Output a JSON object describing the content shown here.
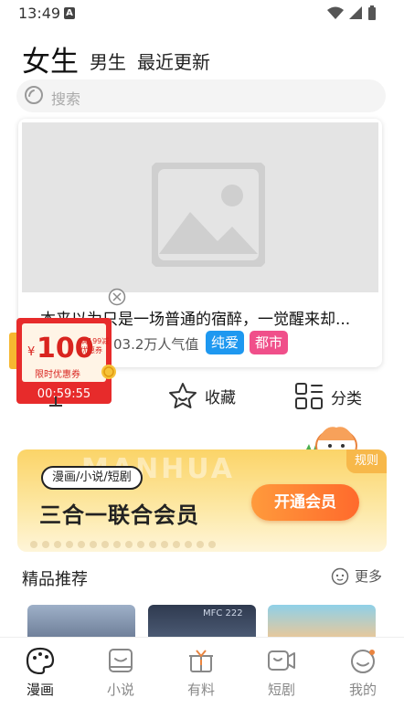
{
  "status_bar": {
    "time": "13:49",
    "sim_badge": "A"
  },
  "top_tabs": [
    {
      "label": "女生",
      "active": true
    },
    {
      "label": "男生",
      "active": false
    },
    {
      "label": "最近更新",
      "active": false
    }
  ],
  "search": {
    "placeholder": "搜索"
  },
  "banner": {
    "title": "本来以为只是一场普通的宿醉，一觉醒来却...",
    "popularity": "03.2万人气值",
    "tags": [
      "纯爱",
      "都市"
    ]
  },
  "coupon": {
    "currency": "¥",
    "amount": "100",
    "condition": "满199减优惠券",
    "label": "限时优惠券",
    "countdown": "00:59:55"
  },
  "quick_actions": {
    "favorites": "收藏",
    "categories": "分类"
  },
  "promo": {
    "pill": "漫画/小说/短剧",
    "title": "三合一联合会员",
    "button": "开通会员",
    "rules": "规则",
    "watermark": "MANHUA"
  },
  "recommended": {
    "title": "精品推荐",
    "more": "更多",
    "thumb_2_text": "MFC 222"
  },
  "bottom_nav": [
    {
      "label": "漫画",
      "icon": "palette-icon",
      "active": true
    },
    {
      "label": "小说",
      "icon": "book-icon",
      "active": false
    },
    {
      "label": "有料",
      "icon": "gift-icon",
      "active": false
    },
    {
      "label": "短剧",
      "icon": "video-icon",
      "active": false
    },
    {
      "label": "我的",
      "icon": "profile-icon",
      "active": false
    }
  ],
  "colors": {
    "tag_blue": "#1e98f0",
    "tag_pink": "#f04f8a",
    "coupon_red": "#e72b2b",
    "promo_orange": "#ff7a2c"
  }
}
